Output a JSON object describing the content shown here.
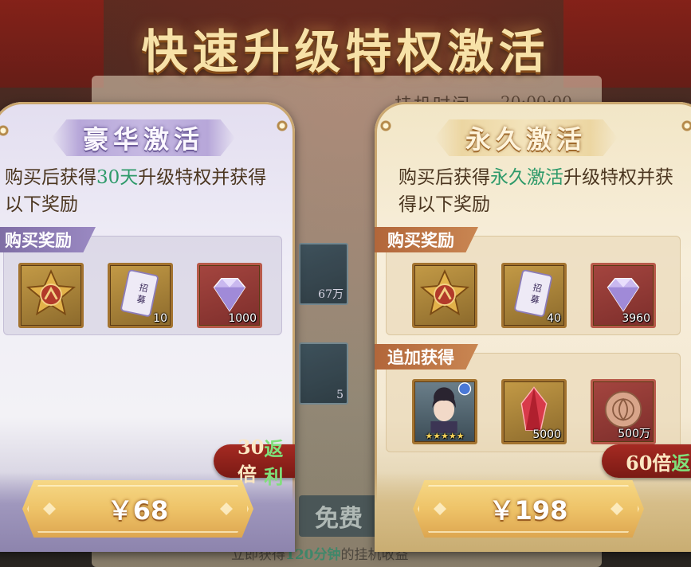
{
  "title": "快速升级特权激活",
  "background": {
    "idle_label": "挂机时间:",
    "idle_time": "20:00:00",
    "cells": [
      "67万",
      "5"
    ],
    "free_label": "免费",
    "bottom_text_prefix": "立即获得",
    "bottom_text_highlight": "120分钟",
    "bottom_text_suffix": "的挂机收益"
  },
  "cards": {
    "luxury": {
      "header": "豪华激活",
      "desc_prefix": "购买后获得",
      "desc_highlight": "30天",
      "desc_suffix": "升级特权并获得以下奖励",
      "section_label": "购买奖励",
      "items": [
        {
          "icon": "medal-icon",
          "qty": ""
        },
        {
          "icon": "recruit-ticket-icon",
          "qty": "10"
        },
        {
          "icon": "diamond-icon",
          "qty": "1000"
        }
      ],
      "rebate_multiplier": "30倍",
      "rebate_word": "返利",
      "price": "￥68"
    },
    "permanent": {
      "header": "永久激活",
      "desc_prefix": "购买后获得",
      "desc_highlight": "永久激活",
      "desc_suffix": "升级特权并获得以下奖励",
      "section_label": "购买奖励",
      "items": [
        {
          "icon": "medal-icon",
          "qty": ""
        },
        {
          "icon": "recruit-ticket-icon",
          "qty": "40"
        },
        {
          "icon": "diamond-icon",
          "qty": "3960"
        }
      ],
      "extra_label": "追加获得",
      "extra_items": [
        {
          "icon": "character-portrait-icon",
          "stars": "★★★★★"
        },
        {
          "icon": "red-crystal-icon",
          "qty": "5000"
        },
        {
          "icon": "copper-coin-icon",
          "qty": "500万"
        }
      ],
      "rebate_multiplier": "60倍",
      "rebate_word": "返",
      "price": "￥198"
    }
  },
  "colors": {
    "highlight_green": "#2e9a6a",
    "rebate_green": "#7fe07a",
    "button_gold": "#eec368",
    "badge_red": "#a52a22"
  }
}
